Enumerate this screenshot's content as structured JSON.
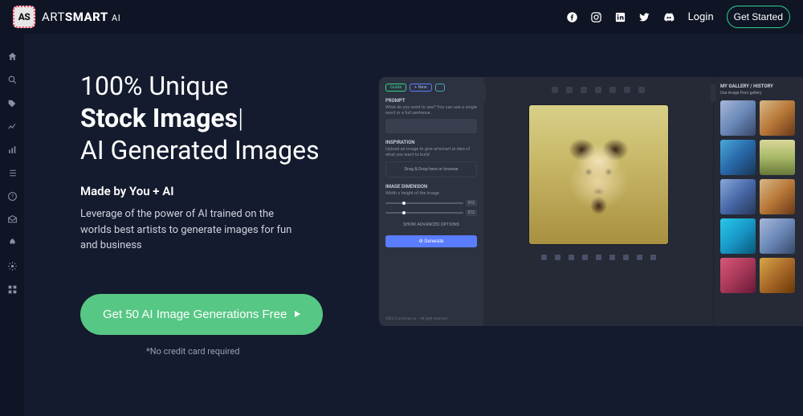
{
  "brand": {
    "mark_text": "AS",
    "name_part1": "ART",
    "name_bold": "SMART",
    "name_suffix": "AI"
  },
  "topnav": {
    "login_label": "Login",
    "get_started_label": "Get Started"
  },
  "hero": {
    "line1": "100% Unique",
    "line2_bold": "Stock Images",
    "caret": "|",
    "line3": "AI Generated Images",
    "subtitle": "Made by You + AI",
    "desc": "Leverage of the power of AI trained on the worlds best artists to generate images for fun and business",
    "cta_label": "Get 50 AI Image Generations Free",
    "note": "*No credit card required"
  },
  "preview": {
    "chips": {
      "guide": "Guide",
      "new": "+ New",
      "other": ""
    },
    "prompt": {
      "label": "PROMPT",
      "hint": "What do you want to see? You can use a single word or a full sentence.",
      "placeholder": ""
    },
    "inspiration": {
      "label": "INSPIRATION",
      "hint": "Upload an image to give artsmart.ai idea of what you want to build",
      "dropzone": "Drag & Drop here or browse"
    },
    "dimension": {
      "label": "IMAGE DIMENSION",
      "hint": "Width x height of the image",
      "badge": "512"
    },
    "advanced": "SHOW ADVANCED OPTIONS",
    "generate": "⚙ Generate",
    "footer_left": "2022 © artsmart.ai – All right reserved",
    "footer_right": "",
    "gallery": {
      "title": "MY GALLERY / HISTORY",
      "sub": "Use image from gallery"
    }
  }
}
